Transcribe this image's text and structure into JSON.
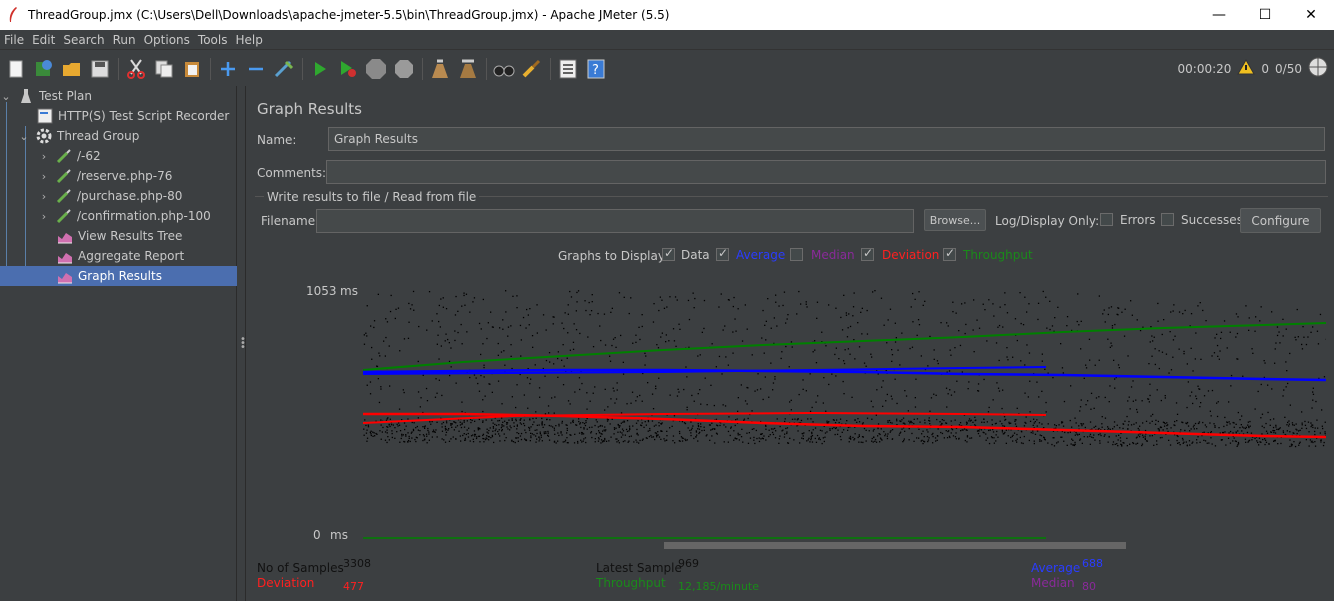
{
  "window": {
    "title": "ThreadGroup.jmx (C:\\Users\\Dell\\Downloads\\apache-jmeter-5.5\\bin\\ThreadGroup.jmx) - Apache JMeter (5.5)",
    "minimize": "—",
    "maximize": "☐",
    "close": "✕"
  },
  "menu": [
    "File",
    "Edit",
    "Search",
    "Run",
    "Options",
    "Tools",
    "Help"
  ],
  "status": {
    "timer": "00:00:20",
    "warnings": "0",
    "threads": "0/50"
  },
  "tree": {
    "test_plan": "Test Plan",
    "recorder": "HTTP(S) Test Script Recorder",
    "thread_group": "Thread Group",
    "req1": "/-62",
    "req2": "/reserve.php-76",
    "req3": "/purchase.php-80",
    "req4": "/confirmation.php-100",
    "view_results_tree": "View Results Tree",
    "aggregate_report": "Aggregate Report",
    "graph_results": "Graph Results"
  },
  "panel": {
    "title": "Graph Results",
    "name_label": "Name:",
    "name_value": "Graph Results",
    "comments_label": "Comments:",
    "comments_value": "",
    "file_section": "Write results to file / Read from file",
    "filename_label": "Filename",
    "filename_value": "",
    "browse": "Browse...",
    "log_display_only": "Log/Display Only:",
    "errors": "Errors",
    "successes": "Successes",
    "configure": "Configure"
  },
  "graphs_to_display": {
    "label": "Graphs to Display",
    "data": "Data",
    "average": "Average",
    "median": "Median",
    "deviation": "Deviation",
    "throughput": "Throughput"
  },
  "colors": {
    "data": "#000000",
    "average": "#0000ff",
    "median": "#800080",
    "deviation": "#ff0000",
    "throughput": "#008000"
  },
  "graph": {
    "y_max": "1053",
    "y_min": "0",
    "unit": "ms"
  },
  "stats": {
    "no_of_samples_label": "No of Samples",
    "no_of_samples": "3308",
    "deviation_label": "Deviation",
    "deviation": "477",
    "latest_sample_label": "Latest Sample",
    "latest_sample": "969",
    "throughput_label": "Throughput",
    "throughput": "12,185/minute",
    "average_label": "Average",
    "average": "688",
    "median_label": "Median",
    "median": "80"
  }
}
